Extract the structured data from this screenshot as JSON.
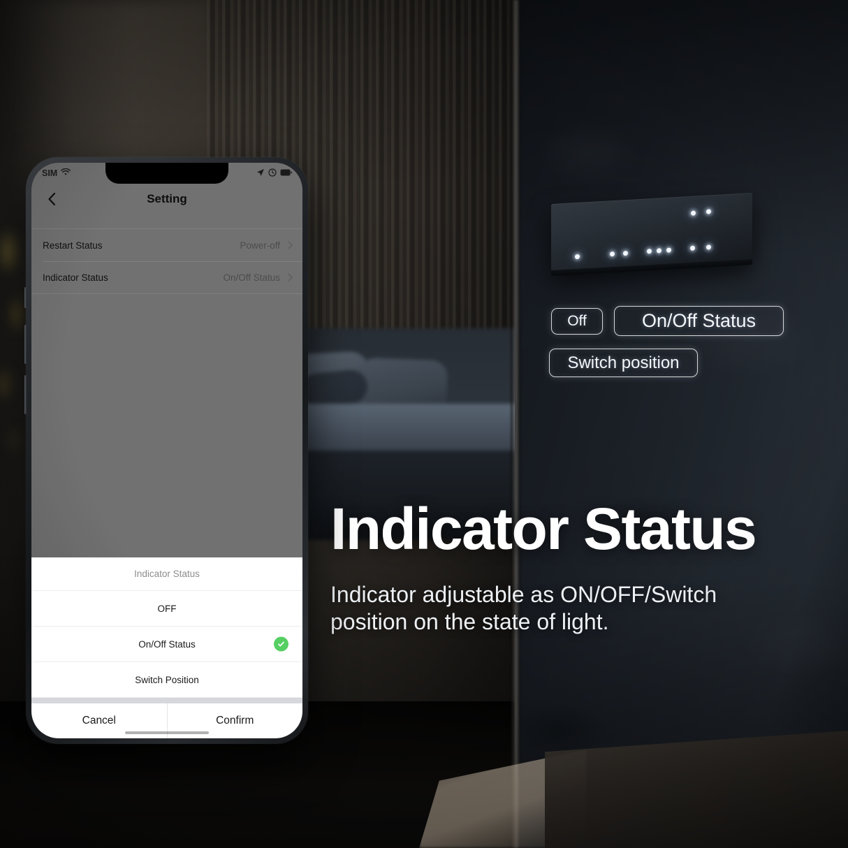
{
  "phone": {
    "statusbar": {
      "carrier": "SIM",
      "wifi_icon": "wifi-icon",
      "location_icon": "location-arrow-icon",
      "alarm_icon": "alarm-clock-icon",
      "battery_icon": "battery-icon"
    },
    "navbar": {
      "back_icon": "chevron-left-icon",
      "title": "Setting"
    },
    "settings_rows": [
      {
        "label": "Restart Status",
        "value": "Power-off",
        "chevron": "chevron-right-icon"
      },
      {
        "label": "Indicator Status",
        "value": "On/Off Status",
        "chevron": "chevron-right-icon"
      }
    ],
    "action_sheet": {
      "title": "Indicator Status",
      "options": [
        {
          "label": "OFF",
          "selected": false
        },
        {
          "label": "On/Off Status",
          "selected": true
        },
        {
          "label": "Switch Position",
          "selected": false
        }
      ],
      "selected_icon": "check-circle-icon",
      "selected_color": "#56cf62",
      "cancel_label": "Cancel",
      "confirm_label": "Confirm"
    }
  },
  "callouts": [
    {
      "id": "off",
      "label": "Off"
    },
    {
      "id": "onoff",
      "label": "On/Off Status"
    },
    {
      "id": "switch",
      "label": "Switch position"
    }
  ],
  "marketing": {
    "headline": "Indicator Status",
    "subtitle": "Indicator adjustable as ON/OFF/Switch position on the state of light."
  },
  "device": {
    "name": "wall-switch-panel",
    "led_count": 11
  },
  "colors": {
    "accent_green": "#56cf62",
    "headline_white": "#ffffff",
    "screen_grey": "#8a8a8a",
    "sheet_white": "#ffffff",
    "wall_right": "#222830",
    "wall_left": "#3a352f"
  }
}
